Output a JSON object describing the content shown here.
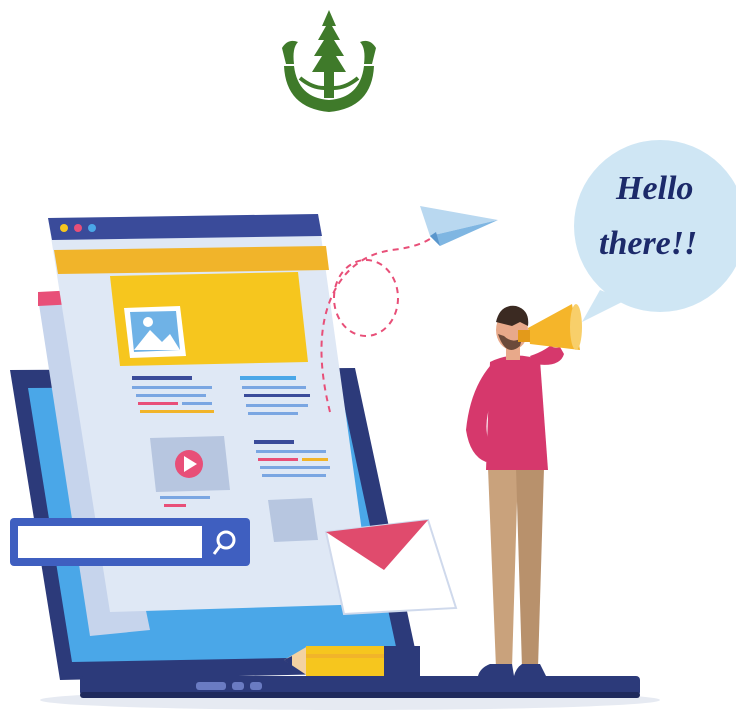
{
  "logo": {
    "icon": "redwood-tree-logo-icon",
    "color": "#3f7a2a"
  },
  "speech_bubble": {
    "line1": "Hello",
    "line2": "there!!"
  },
  "colors": {
    "browser_bg": "#dfe8f5",
    "browser_bar": "#3a4b9a",
    "header_band": "#f1b42a",
    "image_block": "#f6c61e",
    "laptop_frame": "#2c3a7a",
    "laptop_screen": "#4aa7e8",
    "search_bar": "#3f5fc0",
    "envelope_flap": "#e04b6d",
    "shirt": "#d6386c",
    "pants": "#c9a27c",
    "megaphone": "#f5b52a",
    "bubble": "#cfe6f4",
    "text_blue": "#1c2a6a"
  },
  "icons": [
    "image-icon",
    "play-video-icon",
    "search-icon",
    "envelope-icon",
    "paper-plane-icon",
    "megaphone-icon",
    "pencil-icon"
  ]
}
